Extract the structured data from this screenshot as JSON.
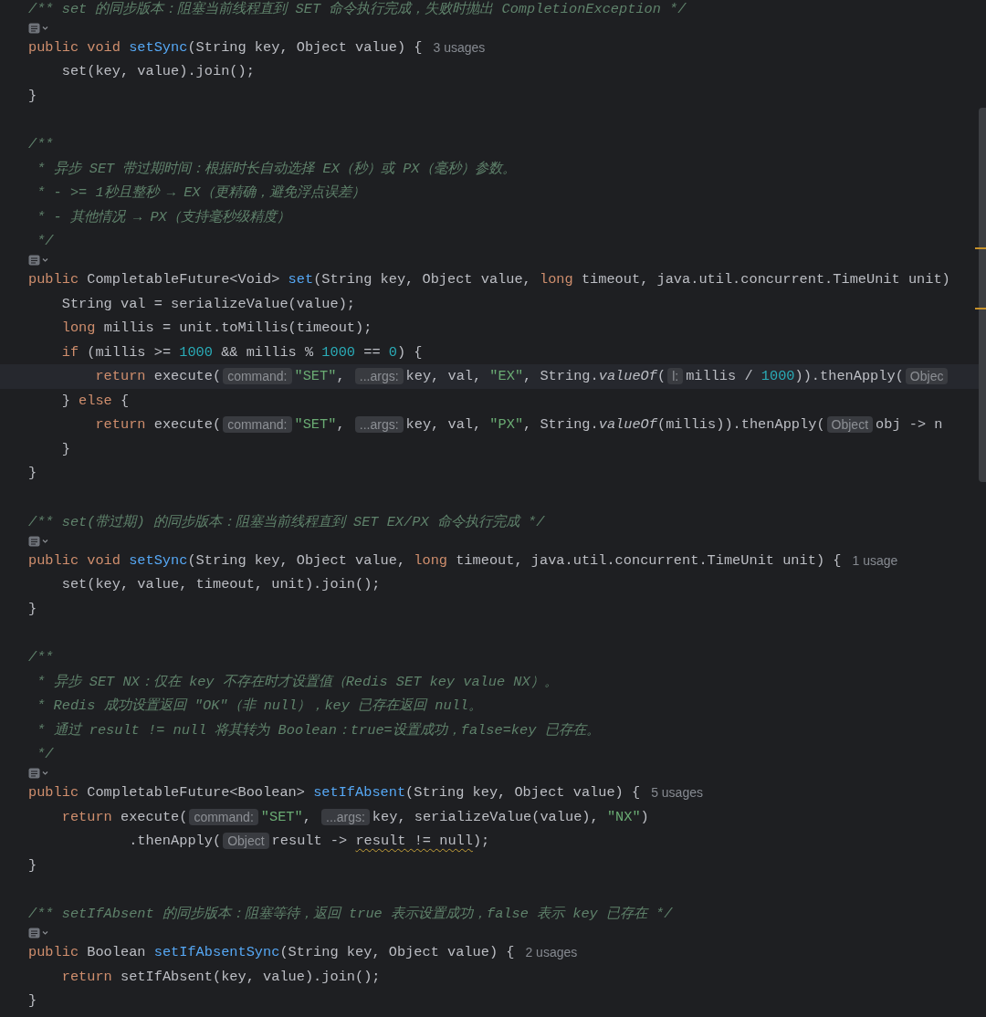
{
  "editor": {
    "lines": [
      {
        "kind": "doc",
        "text": "/** set 的同步版本：阻塞当前线程直到 SET 命令执行完成，失败时抛出 CompletionException */"
      },
      {
        "kind": "lens"
      },
      {
        "kind": "code",
        "tokens": [
          {
            "kind": "kw",
            "text": "public void "
          },
          {
            "kind": "fn",
            "text": "setSync"
          },
          {
            "kind": "plain",
            "text": "(String key, Object value) {"
          },
          {
            "kind": "usage",
            "text": "3 usages"
          }
        ]
      },
      {
        "kind": "code",
        "tokens": [
          {
            "kind": "plain",
            "text": "    set(key, value).join();"
          }
        ]
      },
      {
        "kind": "code",
        "tokens": [
          {
            "kind": "plain",
            "text": "}"
          }
        ]
      },
      {
        "kind": "blank"
      },
      {
        "kind": "doc",
        "text": "/**"
      },
      {
        "kind": "doc",
        "text": " * 异步 SET 带过期时间：根据时长自动选择 EX（秒）或 PX（毫秒）参数。"
      },
      {
        "kind": "doc",
        "text": " * - >= 1秒且整秒 → EX（更精确，避免浮点误差）"
      },
      {
        "kind": "doc",
        "text": " * - 其他情况 → PX（支持毫秒级精度）"
      },
      {
        "kind": "doc",
        "text": " */"
      },
      {
        "kind": "lens"
      },
      {
        "kind": "code",
        "tokens": [
          {
            "kind": "kw",
            "text": "public "
          },
          {
            "kind": "plain",
            "text": "CompletableFuture<Void> "
          },
          {
            "kind": "fn",
            "text": "set"
          },
          {
            "kind": "plain",
            "text": "(String key, Object value, "
          },
          {
            "kind": "kw",
            "text": "long "
          },
          {
            "kind": "plain",
            "text": "timeout, java.util.concurrent.TimeUnit unit)"
          }
        ]
      },
      {
        "kind": "code",
        "tokens": [
          {
            "kind": "plain",
            "text": "    String val = serializeValue(value);"
          }
        ]
      },
      {
        "kind": "code",
        "tokens": [
          {
            "kind": "kw",
            "text": "    long "
          },
          {
            "kind": "plain",
            "text": "millis = unit.toMillis(timeout);"
          }
        ]
      },
      {
        "kind": "code",
        "tokens": [
          {
            "kind": "kw",
            "text": "    if "
          },
          {
            "kind": "plain",
            "text": "(millis >= "
          },
          {
            "kind": "num",
            "text": "1000"
          },
          {
            "kind": "plain",
            "text": " && millis % "
          },
          {
            "kind": "num",
            "text": "1000"
          },
          {
            "kind": "plain",
            "text": " == "
          },
          {
            "kind": "num",
            "text": "0"
          },
          {
            "kind": "plain",
            "text": ") {"
          }
        ]
      },
      {
        "kind": "code",
        "current": true,
        "tokens": [
          {
            "kind": "kw",
            "text": "        return "
          },
          {
            "kind": "plain",
            "text": "execute("
          },
          {
            "kind": "hint",
            "text": "command:"
          },
          {
            "kind": "str",
            "text": "\"SET\""
          },
          {
            "kind": "plain",
            "text": ", "
          },
          {
            "kind": "hint",
            "text": "...args:"
          },
          {
            "kind": "plain",
            "text": "key, val, "
          },
          {
            "kind": "str",
            "text": "\"EX\""
          },
          {
            "kind": "plain",
            "text": ", String."
          },
          {
            "kind": "italic",
            "text": "valueOf"
          },
          {
            "kind": "plain",
            "text": "("
          },
          {
            "kind": "hint",
            "text": "l:"
          },
          {
            "kind": "plain",
            "text": "millis / "
          },
          {
            "kind": "num",
            "text": "1000"
          },
          {
            "kind": "plain",
            "text": ")).thenApply("
          },
          {
            "kind": "hint",
            "text": "Objec"
          }
        ]
      },
      {
        "kind": "code",
        "tokens": [
          {
            "kind": "plain",
            "text": "    } "
          },
          {
            "kind": "kw",
            "text": "else "
          },
          {
            "kind": "plain",
            "text": "{"
          }
        ]
      },
      {
        "kind": "code",
        "tokens": [
          {
            "kind": "kw",
            "text": "        return "
          },
          {
            "kind": "plain",
            "text": "execute("
          },
          {
            "kind": "hint",
            "text": "command:"
          },
          {
            "kind": "str",
            "text": "\"SET\""
          },
          {
            "kind": "plain",
            "text": ", "
          },
          {
            "kind": "hint",
            "text": "...args:"
          },
          {
            "kind": "plain",
            "text": "key, val, "
          },
          {
            "kind": "str",
            "text": "\"PX\""
          },
          {
            "kind": "plain",
            "text": ", String."
          },
          {
            "kind": "italic",
            "text": "valueOf"
          },
          {
            "kind": "plain",
            "text": "(millis)).thenApply("
          },
          {
            "kind": "hint",
            "text": "Object"
          },
          {
            "kind": "plain",
            "text": "obj -> n"
          }
        ]
      },
      {
        "kind": "code",
        "tokens": [
          {
            "kind": "plain",
            "text": "    }"
          }
        ]
      },
      {
        "kind": "code",
        "tokens": [
          {
            "kind": "plain",
            "text": "}"
          }
        ]
      },
      {
        "kind": "blank"
      },
      {
        "kind": "doc",
        "text": "/** set(带过期) 的同步版本：阻塞当前线程直到 SET EX/PX 命令执行完成 */"
      },
      {
        "kind": "lens"
      },
      {
        "kind": "code",
        "tokens": [
          {
            "kind": "kw",
            "text": "public void "
          },
          {
            "kind": "fn",
            "text": "setSync"
          },
          {
            "kind": "plain",
            "text": "(String key, Object value, "
          },
          {
            "kind": "kw",
            "text": "long "
          },
          {
            "kind": "plain",
            "text": "timeout, java.util.concurrent.TimeUnit unit) {"
          },
          {
            "kind": "usage",
            "text": "1 usage"
          }
        ]
      },
      {
        "kind": "code",
        "tokens": [
          {
            "kind": "plain",
            "text": "    set(key, value, timeout, unit).join();"
          }
        ]
      },
      {
        "kind": "code",
        "tokens": [
          {
            "kind": "plain",
            "text": "}"
          }
        ]
      },
      {
        "kind": "blank"
      },
      {
        "kind": "doc",
        "text": "/**"
      },
      {
        "kind": "doc",
        "text": " * 异步 SET NX：仅在 key 不存在时才设置值（Redis SET key value NX）。"
      },
      {
        "kind": "doc",
        "text": " * Redis 成功设置返回 \"OK\"（非 null），key 已存在返回 null。"
      },
      {
        "kind": "doc",
        "text": " * 通过 result != null 将其转为 Boolean：true=设置成功，false=key 已存在。"
      },
      {
        "kind": "doc",
        "text": " */"
      },
      {
        "kind": "lens"
      },
      {
        "kind": "code",
        "tokens": [
          {
            "kind": "kw",
            "text": "public "
          },
          {
            "kind": "plain",
            "text": "CompletableFuture<Boolean> "
          },
          {
            "kind": "fn",
            "text": "setIfAbsent"
          },
          {
            "kind": "plain",
            "text": "(String key, Object value) {"
          },
          {
            "kind": "usage",
            "text": "5 usages"
          }
        ]
      },
      {
        "kind": "code",
        "tokens": [
          {
            "kind": "kw",
            "text": "    return "
          },
          {
            "kind": "plain",
            "text": "execute("
          },
          {
            "kind": "hint",
            "text": "command:"
          },
          {
            "kind": "str",
            "text": "\"SET\""
          },
          {
            "kind": "plain",
            "text": ", "
          },
          {
            "kind": "hint",
            "text": "...args:"
          },
          {
            "kind": "plain",
            "text": "key, serializeValue(value), "
          },
          {
            "kind": "str",
            "text": "\"NX\""
          },
          {
            "kind": "plain",
            "text": ")"
          }
        ]
      },
      {
        "kind": "code",
        "tokens": [
          {
            "kind": "plain",
            "text": "            .thenApply("
          },
          {
            "kind": "hint",
            "text": "Object"
          },
          {
            "kind": "plain",
            "text": "result -> "
          },
          {
            "kind": "warn",
            "text": "result != null"
          },
          {
            "kind": "plain",
            "text": ");"
          }
        ]
      },
      {
        "kind": "code",
        "tokens": [
          {
            "kind": "plain",
            "text": "}"
          }
        ]
      },
      {
        "kind": "blank"
      },
      {
        "kind": "doc",
        "text": "/** setIfAbsent 的同步版本：阻塞等待，返回 true 表示设置成功，false 表示 key 已存在 */"
      },
      {
        "kind": "lens"
      },
      {
        "kind": "code",
        "tokens": [
          {
            "kind": "kw",
            "text": "public "
          },
          {
            "kind": "plain",
            "text": "Boolean "
          },
          {
            "kind": "fn",
            "text": "setIfAbsentSync"
          },
          {
            "kind": "plain",
            "text": "(String key, Object value) {"
          },
          {
            "kind": "usage",
            "text": "2 usages"
          }
        ]
      },
      {
        "kind": "code",
        "tokens": [
          {
            "kind": "kw",
            "text": "    return "
          },
          {
            "kind": "plain",
            "text": "setIfAbsent(key, value).join();"
          }
        ]
      },
      {
        "kind": "code",
        "tokens": [
          {
            "kind": "plain",
            "text": "}"
          }
        ]
      }
    ]
  }
}
